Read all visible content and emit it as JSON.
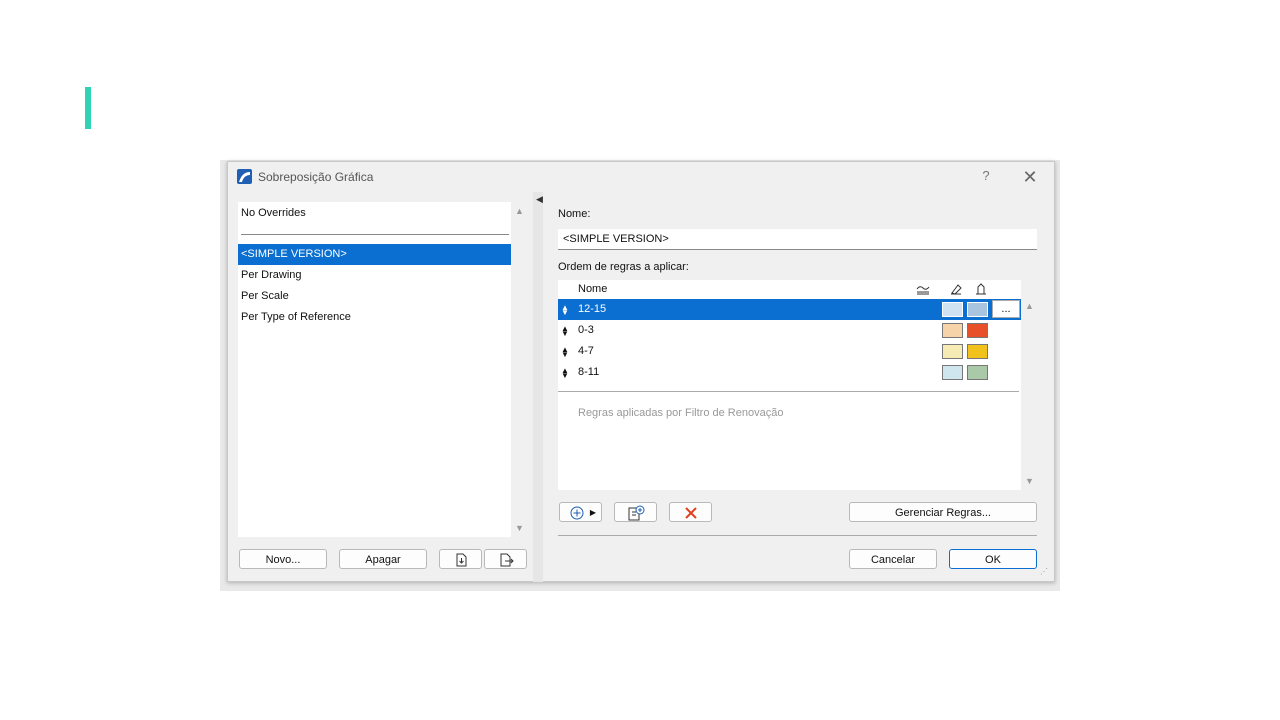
{
  "window": {
    "title": "Sobreposição Gráfica",
    "help": "?",
    "close": "✕"
  },
  "left": {
    "items": [
      {
        "label": "No Overrides"
      },
      {
        "label": "<SIMPLE VERSION>",
        "selected": true
      },
      {
        "label": "Per Drawing"
      },
      {
        "label": "Per Scale"
      },
      {
        "label": "Per Type of Reference"
      }
    ],
    "buttons": {
      "new": "Novo...",
      "delete": "Apagar"
    }
  },
  "right": {
    "name_label": "Nome:",
    "name_value": "<SIMPLE VERSION>",
    "rules_label": "Ordem de regras a aplicar:",
    "rules_col_name": "Nome",
    "rules": [
      {
        "name": "12-15",
        "selected": true,
        "fill": "#cfe3f2",
        "bg": "#a9c4de"
      },
      {
        "name": "0-3",
        "fill": "#f6d3a8",
        "bg": "#e8502a"
      },
      {
        "name": "4-7",
        "fill": "#f6ebb4",
        "bg": "#f2c21c"
      },
      {
        "name": "8-11",
        "fill": "#cfe6ee",
        "bg": "#a9c9a8"
      }
    ],
    "more_label": "...",
    "renovation_hint": "Regras aplicadas por Filtro de Renovação",
    "manage_rules": "Gerenciar Regras...",
    "cancel": "Cancelar",
    "ok": "OK"
  },
  "colors": {
    "accent": "#2fd3b4",
    "selection": "#0a6fd0",
    "delete_x": "#e0401e"
  }
}
